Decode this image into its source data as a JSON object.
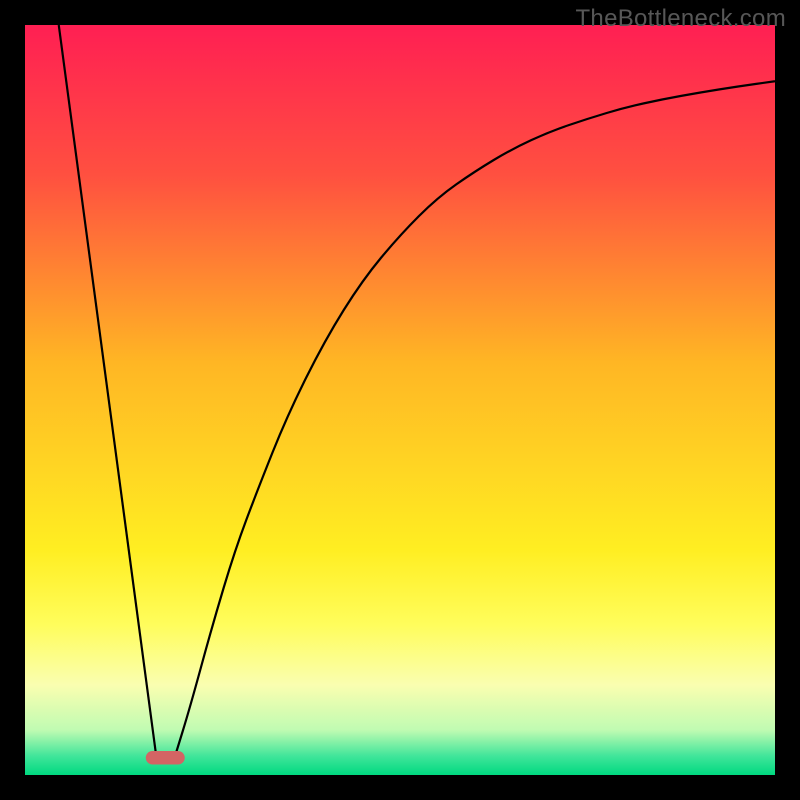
{
  "watermark": "TheBottleneck.com",
  "chart_data": {
    "type": "line",
    "title": "",
    "xlabel": "",
    "ylabel": "",
    "xlim": [
      0,
      100
    ],
    "ylim": [
      0,
      100
    ],
    "background_gradient_stops": [
      {
        "offset": 0.0,
        "color": "#ff1f53"
      },
      {
        "offset": 0.2,
        "color": "#ff5040"
      },
      {
        "offset": 0.45,
        "color": "#ffb624"
      },
      {
        "offset": 0.7,
        "color": "#ffee22"
      },
      {
        "offset": 0.8,
        "color": "#fffd5c"
      },
      {
        "offset": 0.88,
        "color": "#fafeb0"
      },
      {
        "offset": 0.94,
        "color": "#c0fbb2"
      },
      {
        "offset": 0.975,
        "color": "#40e59a"
      },
      {
        "offset": 1.0,
        "color": "#00d980"
      }
    ],
    "series": [
      {
        "name": "left-line",
        "x": [
          4.5,
          17.5
        ],
        "y": [
          100,
          2.5
        ]
      },
      {
        "name": "right-curve",
        "x": [
          20,
          22,
          25,
          28,
          31,
          35,
          40,
          45,
          50,
          55,
          60,
          65,
          70,
          75,
          80,
          85,
          90,
          95,
          100
        ],
        "y": [
          2.5,
          9,
          20,
          30,
          38,
          48,
          58,
          66,
          72,
          77,
          80.5,
          83.5,
          85.8,
          87.5,
          89,
          90.1,
          91,
          91.8,
          92.5
        ]
      }
    ],
    "pill_marker": {
      "x": 18.7,
      "y": 2.3,
      "width": 5.2,
      "height": 1.8,
      "color": "#d36464"
    }
  }
}
